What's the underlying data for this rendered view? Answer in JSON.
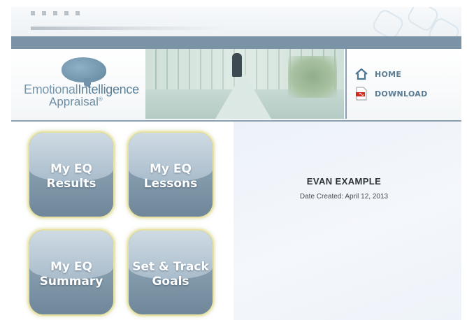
{
  "header": {
    "logo": {
      "line1_part1": "Emotional",
      "line1_part2": "Intelligence",
      "line2": "Appraisal",
      "mark": "®"
    },
    "nav": [
      {
        "label": "HOME",
        "icon": "home-icon"
      },
      {
        "label": "DOWNLOAD",
        "icon": "pdf-icon"
      }
    ]
  },
  "tiles": [
    {
      "line1": "My EQ",
      "line2": "Results"
    },
    {
      "line1": "My EQ",
      "line2": "Lessons"
    },
    {
      "line1": "My EQ",
      "line2": "Summary"
    },
    {
      "line1": "Set & Track",
      "line2": "Goals"
    }
  ],
  "profile": {
    "name": "EVAN EXAMPLE",
    "date_created": "Date Created: April 12, 2013"
  },
  "colors": {
    "accent": "#7b93a6",
    "nav_text": "#5b7c93",
    "tile_border": "#e6e2a6"
  }
}
